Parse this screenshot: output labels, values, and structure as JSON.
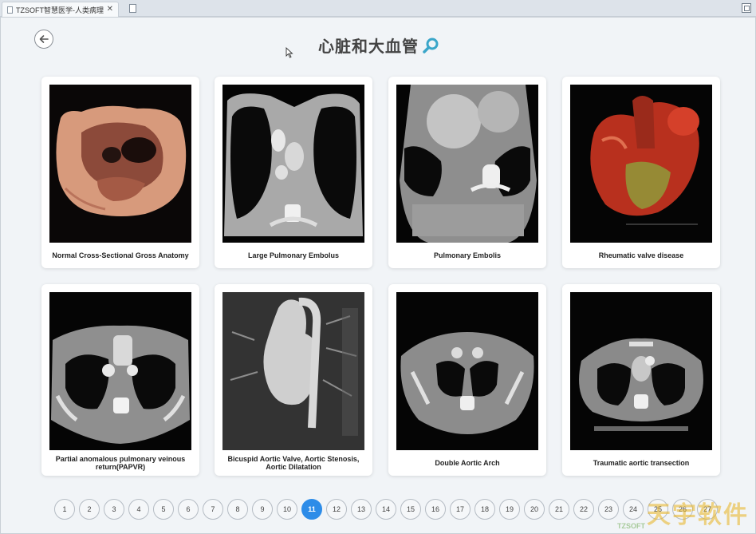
{
  "browser": {
    "tab_title": "TZSOFT智慧医学-人类病理诊断",
    "tab_close": "✕"
  },
  "header": {
    "title": "心脏和大血管",
    "back_icon": "arrow-left-icon",
    "search_icon": "search-icon"
  },
  "cards": [
    {
      "caption": "Normal Cross-Sectional Gross Anatomy"
    },
    {
      "caption": "Large Pulmonary Embolus"
    },
    {
      "caption": "Pulmonary Embolis"
    },
    {
      "caption": "Rheumatic valve disease"
    },
    {
      "caption": "Partial anomalous pulmonary veinous return(PAPVR)"
    },
    {
      "caption": "Bicuspid Aortic Valve, Aortic Stenosis, Aortic Dilatation"
    },
    {
      "caption": "Double Aortic Arch"
    },
    {
      "caption": "Traumatic aortic transection"
    }
  ],
  "pagination": {
    "pages": [
      "1",
      "2",
      "3",
      "4",
      "5",
      "6",
      "7",
      "8",
      "9",
      "10",
      "11",
      "12",
      "13",
      "14",
      "15",
      "16",
      "17",
      "18",
      "19",
      "20",
      "21",
      "22",
      "23",
      "24",
      "25",
      "26",
      "27"
    ],
    "current": "11"
  },
  "watermark": {
    "text": "天宇软件",
    "sub": "TZSOFT"
  },
  "colors": {
    "accent": "#2d8ce8",
    "search_icon": "#3aa6c9"
  }
}
